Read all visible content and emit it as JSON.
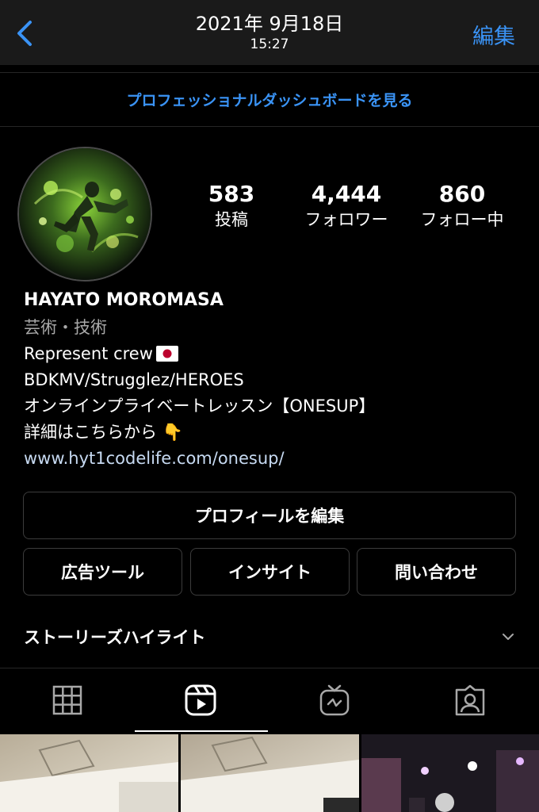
{
  "header": {
    "date": "2021年 9月18日",
    "time": "15:27",
    "edit_label": "編集",
    "back_icon": "chevron-left-icon"
  },
  "dashboard_link": "プロフェッショナルダッシュボードを見る",
  "stats": {
    "posts": {
      "count": "583",
      "label": "投稿"
    },
    "followers": {
      "count": "4,444",
      "label": "フォロワー"
    },
    "following": {
      "count": "860",
      "label": "フォロー中"
    }
  },
  "bio": {
    "name": "HAYATO MOROMASA",
    "category": "芸術・技術",
    "lines": [
      "Represent crew",
      "BDKMV/Strugglez/HEROES",
      "オンラインプライベートレッスン【ONESUP】",
      "詳細はこちらから 👇"
    ],
    "link": "www.hyt1codelife.com/onesup/"
  },
  "buttons": {
    "edit_profile": "プロフィールを編集",
    "ad_tools": "広告ツール",
    "insights": "インサイト",
    "contact": "問い合わせ"
  },
  "highlights": {
    "label": "ストーリーズハイライト",
    "toggle_icon": "chevron-down-icon"
  },
  "tabs": [
    {
      "icon": "grid-icon",
      "active": false
    },
    {
      "icon": "reels-icon",
      "active": true
    },
    {
      "icon": "igtv-icon",
      "active": false
    },
    {
      "icon": "tagged-icon",
      "active": false
    }
  ],
  "colors": {
    "accent": "#3a93f5",
    "link": "#c7daf2",
    "background": "#000000",
    "header_bg": "#1a1a1a"
  }
}
